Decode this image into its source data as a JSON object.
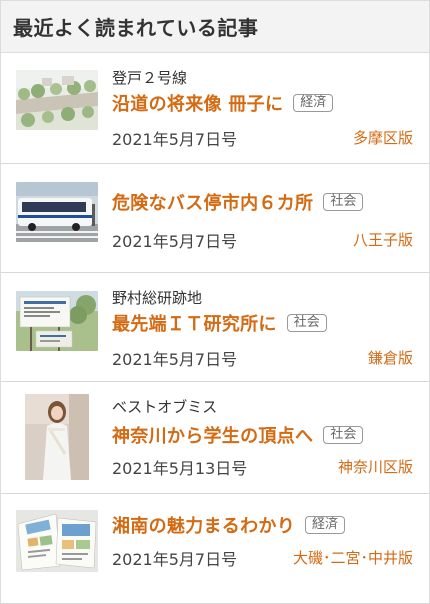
{
  "widget": {
    "title": "最近よく読まれている記事"
  },
  "articles": [
    {
      "supertitle": "登戸２号線",
      "title": "沿道の将来像 冊子に",
      "tag": "経済",
      "date": "2021年5月7日号",
      "edition": "多摩区版",
      "thumbnail": "aerial-street-view-illustration"
    },
    {
      "supertitle": "",
      "title": "危険なバス停市内６カ所",
      "tag": "社会",
      "date": "2021年5月7日号",
      "edition": "八王子版",
      "thumbnail": "bus-at-stop-photo"
    },
    {
      "supertitle": "野村総研跡地",
      "title": "最先端ＩＴ研究所に",
      "tag": "社会",
      "date": "2021年5月7日号",
      "edition": "鎌倉版",
      "thumbnail": "research-site-signboard-photo"
    },
    {
      "supertitle": "ベストオブミス",
      "title": "神奈川から学生の頂点へ",
      "tag": "社会",
      "date": "2021年5月13日号",
      "edition": "神奈川区版",
      "thumbnail": "woman-in-white-dress-photo"
    },
    {
      "supertitle": "",
      "title": "湘南の魅力まるわかり",
      "tag": "経済",
      "date": "2021年5月7日号",
      "edition": "大磯･二宮･中井版",
      "thumbnail": "guidebook-pages-photo"
    }
  ],
  "colors": {
    "accent": "#d46a12",
    "tag_border": "#999999",
    "header_bg": "#f3f3f3"
  }
}
